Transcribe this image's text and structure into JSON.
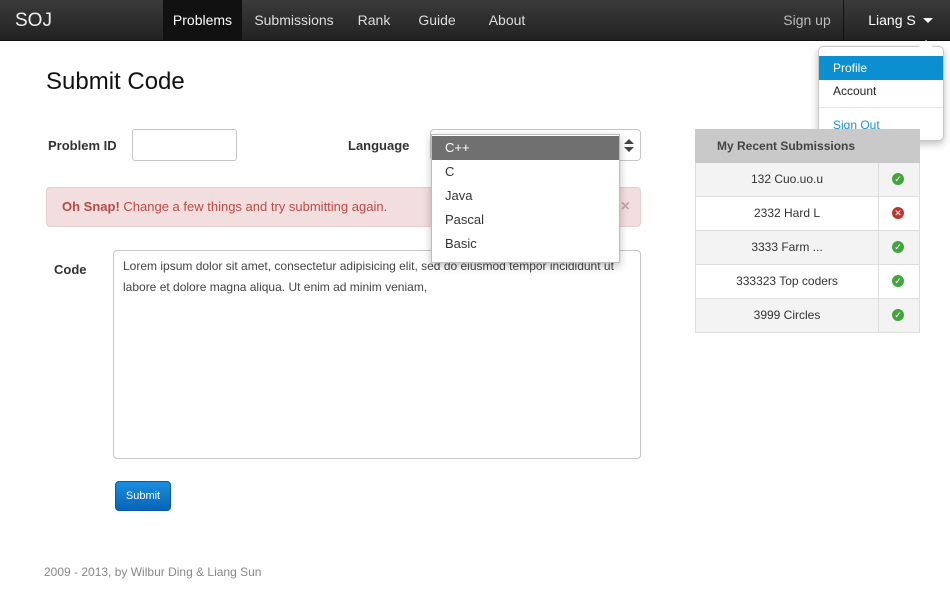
{
  "brand": "SOJ",
  "nav": {
    "items": [
      {
        "label": "Problems",
        "active": true
      },
      {
        "label": "Submissions",
        "active": false
      },
      {
        "label": "Rank",
        "active": false
      },
      {
        "label": "Guide",
        "active": false
      },
      {
        "label": "About",
        "active": false
      }
    ],
    "signup": "Sign up",
    "user": "Liang S"
  },
  "user_menu": {
    "items": [
      "Profile",
      "Account"
    ],
    "signout": "Sign Out",
    "active_item": "Profile"
  },
  "page_title": "Submit Code",
  "form": {
    "problem_id_label": "Problem ID",
    "problem_id_value": "",
    "language_label": "Language",
    "language_options": [
      "C++",
      "C",
      "Java",
      "Pascal",
      "Basic"
    ],
    "language_selected": "C++",
    "code_label": "Code",
    "code_value": "Lorem ipsum dolor sit amet, consectetur adipisicing elit, sed do eiusmod tempor incididunt ut labore et dolore magna aliqua. Ut enim ad minim veniam,",
    "submit_label": "Submit"
  },
  "alert": {
    "strong": "Oh Snap!",
    "message": "Change a few things and try submitting again.",
    "close": "×"
  },
  "recent": {
    "title": "My Recent Submissions",
    "rows": [
      {
        "name": "132 Cuo.uo.u",
        "status": "accepted"
      },
      {
        "name": "2332 Hard L",
        "status": "failed"
      },
      {
        "name": "3333 Farm ...",
        "status": "accepted"
      },
      {
        "name": "333323 Top coders",
        "status": "accepted"
      },
      {
        "name": "3999 Circles",
        "status": "accepted"
      }
    ]
  },
  "footer": "2009 - 2013, by Wilbur Ding & Liang Sun",
  "colors": {
    "accent": "#0b8fd0",
    "alert_bg": "#f2dede",
    "alert_text": "#b94a48",
    "ok": "#44a53f",
    "fail": "#c0332f"
  }
}
